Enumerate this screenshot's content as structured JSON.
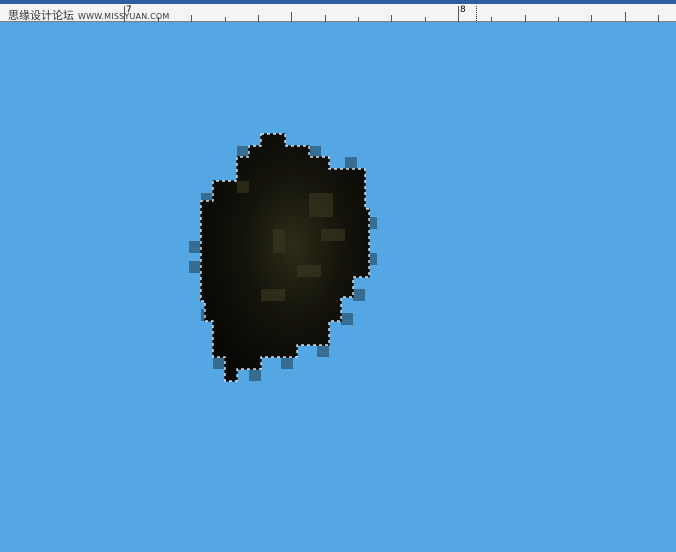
{
  "watermark": {
    "brand": "思缘设计论坛",
    "site": "WWW.MISSYUAN.COM"
  },
  "ruler": {
    "labels": [
      "7",
      "8"
    ]
  },
  "colors": {
    "sky": "#55a7e3",
    "object": "#0f0e08",
    "selection": "#ffffff"
  }
}
